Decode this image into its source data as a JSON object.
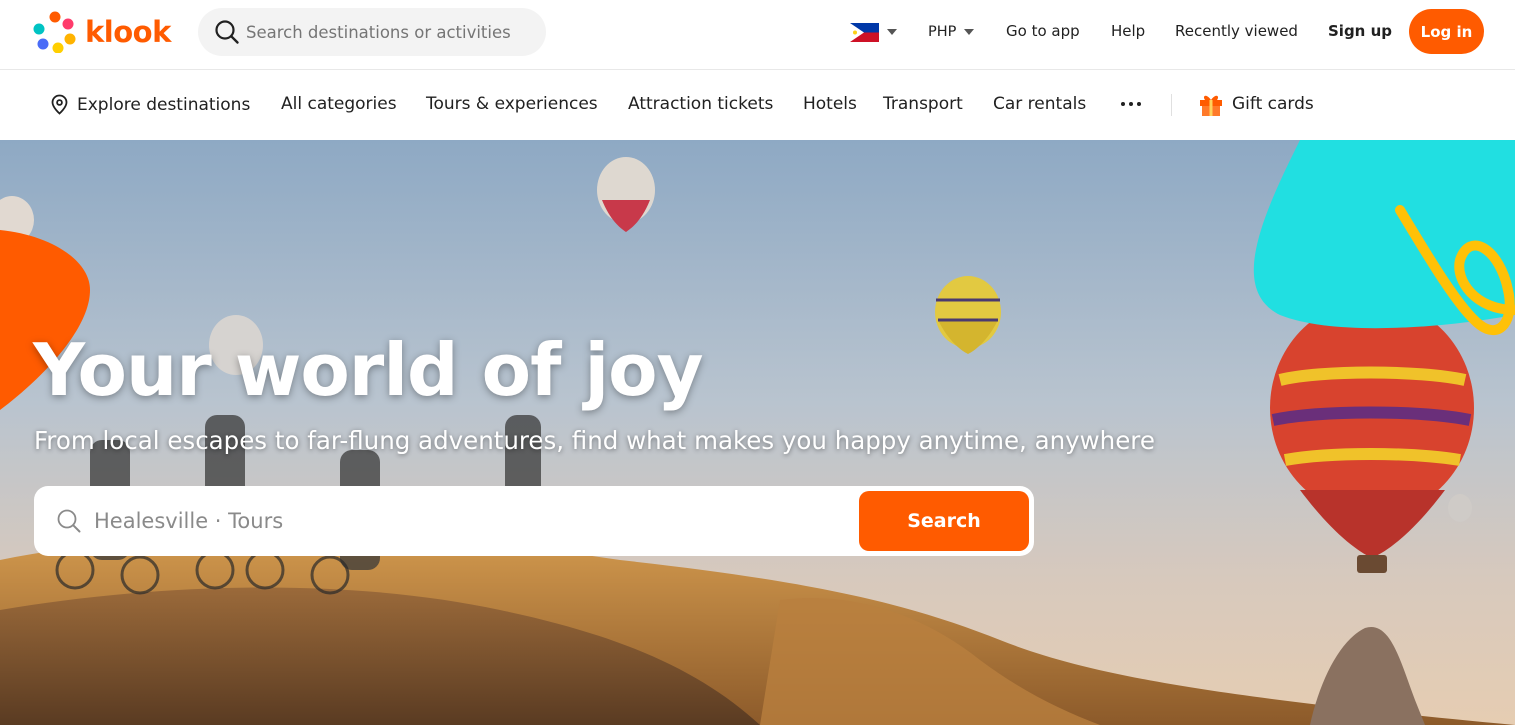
{
  "brand": {
    "name": "klook",
    "accent": "#ff5b00"
  },
  "header": {
    "search_placeholder": "Search destinations or activities",
    "country_flag": "philippines-flag",
    "currency": "PHP",
    "links": {
      "go_to_app": "Go to app",
      "help": "Help",
      "recently_viewed": "Recently viewed",
      "sign_up": "Sign up",
      "log_in": "Log in"
    }
  },
  "nav": {
    "explore": "Explore destinations",
    "items": [
      "All categories",
      "Tours & experiences",
      "Attraction tickets",
      "Hotels",
      "Transport",
      "Car rentals"
    ],
    "more_icon": "more-dots-icon",
    "gift_cards": "Gift cards"
  },
  "hero": {
    "title": "Your world of joy",
    "subtitle": "From local escapes to far-flung adventures, find what makes you happy anytime, anywhere",
    "search_placeholder": "Healesville · Tours",
    "search_button": "Search"
  }
}
